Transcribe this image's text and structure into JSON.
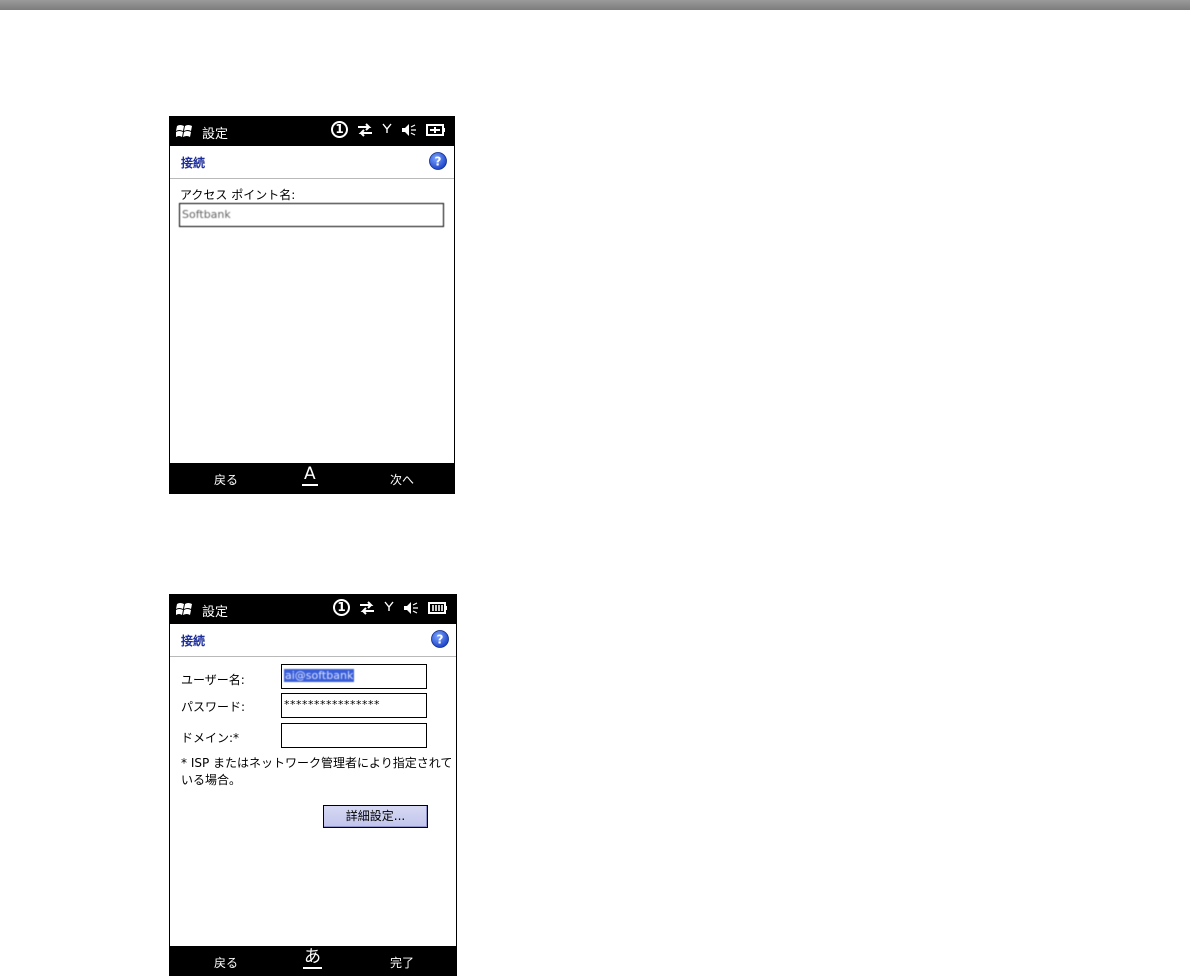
{
  "screen1": {
    "statusbar": {
      "title": "設定",
      "line_number": "1",
      "icons": [
        "windows-logo-icon",
        "data-sync-icon",
        "signal-icon",
        "volume-muted-icon",
        "battery-icon"
      ]
    },
    "header": {
      "title": "接続",
      "help_icon": "help-icon"
    },
    "form": {
      "apn_label": "アクセス ポイント名:",
      "apn_value": "Softbank"
    },
    "softkeys": {
      "left": "戻る",
      "input_mode": "A",
      "right": "次へ"
    }
  },
  "screen2": {
    "statusbar": {
      "title": "設定",
      "line_number": "1",
      "icons": [
        "windows-logo-icon",
        "data-sync-icon",
        "signal-icon",
        "volume-muted-icon",
        "battery-full-icon"
      ]
    },
    "header": {
      "title": "接続",
      "help_icon": "help-icon"
    },
    "form": {
      "username_label": "ユーザー名:",
      "username_value": "ai@softbank",
      "password_label": "パスワード:",
      "password_value": "****************",
      "domain_label": "ドメイン:*",
      "domain_value": "",
      "note": "* ISP またはネットワーク管理者により指定されている場合。",
      "advanced_button": "詳細設定..."
    },
    "softkeys": {
      "left": "戻る",
      "input_mode": "あ",
      "right": "完了"
    }
  },
  "colors": {
    "bar_background": "#000000",
    "header_title": "#1f2f9a",
    "selection": "#3a5ed8",
    "button_face": "#c8cbef",
    "top_rule": "#8a8a8a"
  }
}
